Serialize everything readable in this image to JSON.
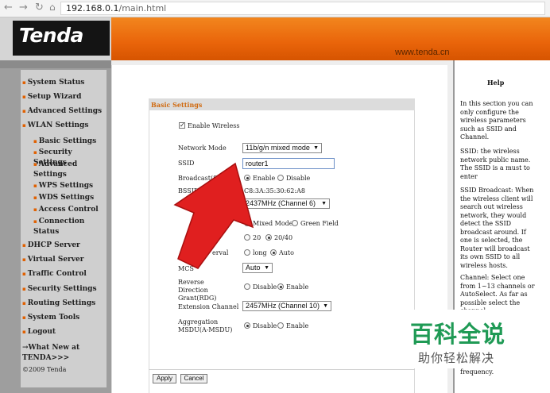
{
  "browser": {
    "url_host": "192.168.0.1",
    "url_path": "/main.html",
    "back_icon": "arrow-left",
    "forward_icon": "arrow-right",
    "reload_icon": "reload",
    "home_icon": "home"
  },
  "header": {
    "logo": "Tenda",
    "website": "www.tenda.cn",
    "accent_color": "#e9640a"
  },
  "sidebar": {
    "items": [
      {
        "label": "System Status"
      },
      {
        "label": "Setup Wizard"
      },
      {
        "label": "Advanced Settings"
      },
      {
        "label": "WLAN Settings"
      },
      {
        "label": "Basic Settings"
      },
      {
        "label": "Security Settings"
      },
      {
        "label": "Advanced Settings"
      },
      {
        "label": "WPS Settings"
      },
      {
        "label": "WDS Settings"
      },
      {
        "label": "Access Control"
      },
      {
        "label": "Connection Status"
      },
      {
        "label": "DHCP Server"
      },
      {
        "label": "Virtual Server"
      },
      {
        "label": "Traffic Control"
      },
      {
        "label": "Security Settings"
      },
      {
        "label": "Routing Settings"
      },
      {
        "label": "System Tools"
      },
      {
        "label": "Logout"
      }
    ],
    "whatsnew": "→What New at TENDA>>>",
    "copyright": "©2009 Tenda"
  },
  "form": {
    "title": "Basic Settings",
    "enable_wireless": "Enable Wireless",
    "network_mode_label": "Network Mode",
    "network_mode_value": "11b/g/n mixed mode",
    "ssid_label": "SSID",
    "ssid_value": "router1",
    "broadcast_label": "Broadcast(SSID)",
    "enable": "Enable",
    "disable": "Disable",
    "bssid_label": "BSSID",
    "bssid_value": "C8:3A:35:30:62:A8",
    "channel_label": "Ch",
    "channel_value": "2437MHz (Channel 6)",
    "mixed_mode": "Mixed Mode",
    "green_field": "Green Field",
    "bw_20": "20",
    "bw_2040": "20/40",
    "interval_label": "erval",
    "long": "long",
    "auto": "Auto",
    "mcs_label": "MCS",
    "mcs_value": "Auto",
    "rdg_label": "Reverse Direction Grant(RDG)",
    "ext_channel_label": "Extension Channel",
    "ext_channel_value": "2457MHz (Channel 10)",
    "amsdu_label": "Aggregation MSDU(A-MSDU)",
    "apply": "Apply",
    "cancel": "Cancel"
  },
  "help": {
    "title": "Help",
    "p1": "In this section you can only configure the wireless parameters such as SSID and Channel.",
    "p2": "SSID: the wireless network public name. The SSID is a must to enter",
    "p3": "SSID Broadcast: When the wireless client will search out wireless network, they would detect the SSID broadcast around. If one is selected, the Router will broadcast its own SSID to all wireless hosts.",
    "p4": "Channel: Select one from 1~13 channels or AutoSelect. As far as possible select the channel",
    "p5": "frequency."
  },
  "watermark": {
    "line1": "百科全说",
    "line2": "助你轻松解决"
  },
  "arrow_color": "#e01f1f"
}
